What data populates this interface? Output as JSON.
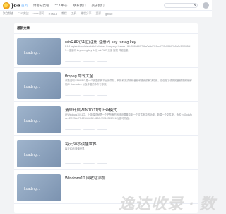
{
  "header": {
    "logo_text": "Joe",
    "nav": [
      "首页",
      "博客分类吧",
      "个人中心",
      "联系我们",
      "关于我们"
    ]
  },
  "subnav": [
    "聚合频道",
    "PHP实战",
    "node源码",
    "HTML5",
    "教程",
    "工具",
    "编程分享",
    "资源",
    "github"
  ],
  "main": {
    "section_title": "最新文章",
    "articles": [
      {
        "thumb": "Loading...",
        "title": "winRAR(64位)注册 注册码 key rarreg.key",
        "excerpt": "RAR registration data which Unlimited Company License UID=5069440f7d6a0e0b0219cc5221d2596f2b9a6b3095d5f49... 注册码 key rarreg.key 64位 winRAR 注册 授权 详细信息"
      },
      {
        "thumb": "Loading...",
        "title": "ffmpeg 命令大全",
        "excerpt": "参数说明 FFMPEG 是一个完整的跨平台的录制、转换和流式传输音频和视频的解决方案，它包括了领先的音频/视频编解码库 libavcodec 以及丰富的命令行参数。"
      },
      {
        "thumb": "Loading...",
        "title": "清单开启WIN10/11的上帝模式",
        "excerpt": "在Windows10/11中，上帝模式就是一个把所有的系统设置集中到一个文件夹中的功能。新建一个文件夹，命名为 GodMode.{ED7BA470-8E54-465E-825C-99712043E01C} 即可开启。"
      },
      {
        "thumb": "Loading...",
        "title": "每天60秒读懂世界",
        "excerpt": "每天60秒读懂世界"
      },
      {
        "thumb": "Loading...",
        "title": "Windows10 回收站添加",
        "excerpt": ""
      }
    ]
  },
  "watermark": "逸达收录 · 数"
}
